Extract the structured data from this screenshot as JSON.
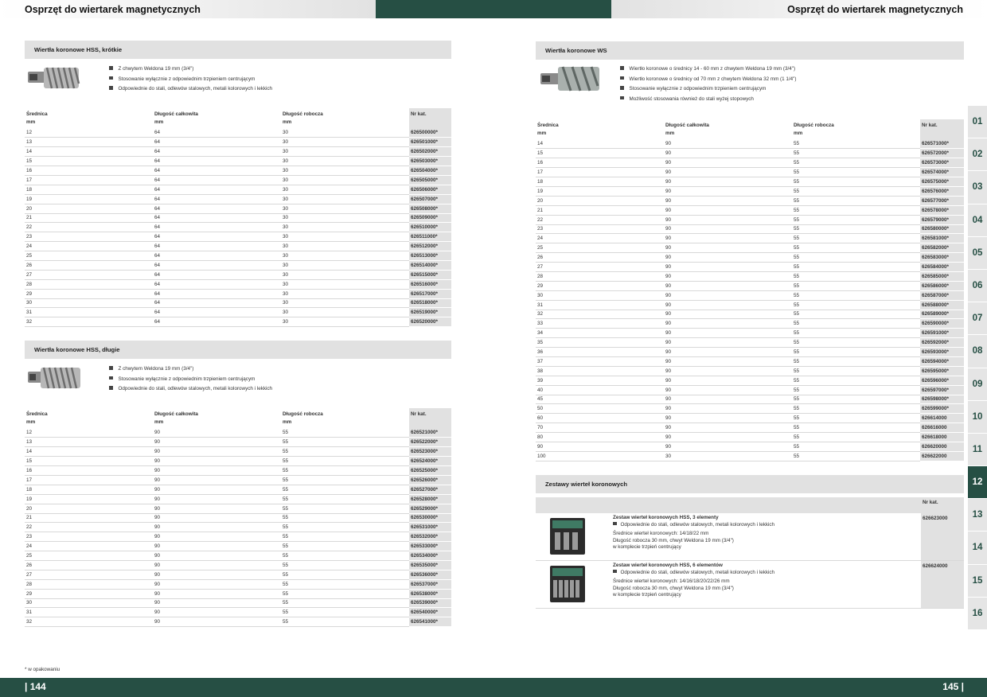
{
  "header": {
    "left_title": "Osprzęt do wiertarek magnetycznych",
    "right_title": "Osprzęt do wiertarek magnetycznych"
  },
  "colors": {
    "brand": "#264f44",
    "section_bg": "#e1e1e1"
  },
  "table_headers": {
    "srednica": "Średnica",
    "dlugosc_calkowita": "Długość całkowita",
    "dlugosc_robocza": "Długość robocza",
    "nr_kat": "Nr kat.",
    "unit": "mm"
  },
  "sec1": {
    "title": "Wiertła koronowe HSS, krótkie",
    "image_icon": "hss-short-core-drill-icon",
    "bullets": [
      "Z chwytem Weldona 19 mm (3/4\")",
      "Stosowanie wyłącznie z odpowiednim trzpieniem centrującym",
      "Odpowiednie do stali, odlewów stalowych, metali kolorowych i lekkich"
    ],
    "rows": [
      [
        "12",
        "64",
        "30",
        "626500000*"
      ],
      [
        "13",
        "64",
        "30",
        "626501000*"
      ],
      [
        "14",
        "64",
        "30",
        "626502000*"
      ],
      [
        "15",
        "64",
        "30",
        "626503000*"
      ],
      [
        "16",
        "64",
        "30",
        "626504000*"
      ],
      [
        "17",
        "64",
        "30",
        "626505000*"
      ],
      [
        "18",
        "64",
        "30",
        "626506000*"
      ],
      [
        "19",
        "64",
        "30",
        "626507000*"
      ],
      [
        "20",
        "64",
        "30",
        "626508000*"
      ],
      [
        "21",
        "64",
        "30",
        "626509000*"
      ],
      [
        "22",
        "64",
        "30",
        "626510000*"
      ],
      [
        "23",
        "64",
        "30",
        "626511000*"
      ],
      [
        "24",
        "64",
        "30",
        "626512000*"
      ],
      [
        "25",
        "64",
        "30",
        "626513000*"
      ],
      [
        "26",
        "64",
        "30",
        "626514000*"
      ],
      [
        "27",
        "64",
        "30",
        "626515000*"
      ],
      [
        "28",
        "64",
        "30",
        "626516000*"
      ],
      [
        "29",
        "64",
        "30",
        "626517000*"
      ],
      [
        "30",
        "64",
        "30",
        "626518000*"
      ],
      [
        "31",
        "64",
        "30",
        "626519000*"
      ],
      [
        "32",
        "64",
        "30",
        "626520000*"
      ]
    ]
  },
  "sec2": {
    "title": "Wiertła koronowe HSS, długie",
    "image_icon": "hss-long-core-drill-icon",
    "bullets": [
      "Z chwytem Weldona 19 mm (3/4\")",
      "Stosowanie wyłącznie z odpowiednim trzpieniem centrującym",
      "Odpowiednie do stali, odlewów stalowych, metali kolorowych i lekkich"
    ],
    "rows": [
      [
        "12",
        "90",
        "55",
        "626521000*"
      ],
      [
        "13",
        "90",
        "55",
        "626522000*"
      ],
      [
        "14",
        "90",
        "55",
        "626523000*"
      ],
      [
        "15",
        "90",
        "55",
        "626524000*"
      ],
      [
        "16",
        "90",
        "55",
        "626525000*"
      ],
      [
        "17",
        "90",
        "55",
        "626526000*"
      ],
      [
        "18",
        "90",
        "55",
        "626527000*"
      ],
      [
        "19",
        "90",
        "55",
        "626528000*"
      ],
      [
        "20",
        "90",
        "55",
        "626529000*"
      ],
      [
        "21",
        "90",
        "55",
        "626530000*"
      ],
      [
        "22",
        "90",
        "55",
        "626531000*"
      ],
      [
        "23",
        "90",
        "55",
        "626532000*"
      ],
      [
        "24",
        "90",
        "55",
        "626533000*"
      ],
      [
        "25",
        "90",
        "55",
        "626534000*"
      ],
      [
        "26",
        "90",
        "55",
        "626535000*"
      ],
      [
        "27",
        "90",
        "55",
        "626536000*"
      ],
      [
        "28",
        "90",
        "55",
        "626537000*"
      ],
      [
        "29",
        "90",
        "55",
        "626538000*"
      ],
      [
        "30",
        "90",
        "55",
        "626539000*"
      ],
      [
        "31",
        "90",
        "55",
        "626540000*"
      ],
      [
        "32",
        "90",
        "55",
        "626541000*"
      ]
    ]
  },
  "sec3": {
    "title": "Wiertła koronowe WS",
    "image_icon": "ws-core-drill-icon",
    "bullets": [
      "Wiertło koronowe o średnicy 14 - 60 mm z chwytem Weldona 19 mm (3/4\")",
      "Wiertło koronowe o średnicy od 70 mm z chwytem Weldona 32 mm (1 1/4\")",
      "Stosowanie wyłącznie z odpowiednim trzpieniem centrującym",
      "Możliwość stosowania również do stali wyżej stopowych"
    ],
    "rows": [
      [
        "14",
        "90",
        "55",
        "626571000*"
      ],
      [
        "15",
        "90",
        "55",
        "626572000*"
      ],
      [
        "16",
        "90",
        "55",
        "626573000*"
      ],
      [
        "17",
        "90",
        "55",
        "626574000*"
      ],
      [
        "18",
        "90",
        "55",
        "626575000*"
      ],
      [
        "19",
        "90",
        "55",
        "626576000*"
      ],
      [
        "20",
        "90",
        "55",
        "626577000*"
      ],
      [
        "21",
        "90",
        "55",
        "626578000*"
      ],
      [
        "22",
        "90",
        "55",
        "626579000*"
      ],
      [
        "23",
        "90",
        "55",
        "626580000*"
      ],
      [
        "24",
        "90",
        "55",
        "626581000*"
      ],
      [
        "25",
        "90",
        "55",
        "626582000*"
      ],
      [
        "26",
        "90",
        "55",
        "626583000*"
      ],
      [
        "27",
        "90",
        "55",
        "626584000*"
      ],
      [
        "28",
        "90",
        "55",
        "626585000*"
      ],
      [
        "29",
        "90",
        "55",
        "626586000*"
      ],
      [
        "30",
        "90",
        "55",
        "626587000*"
      ],
      [
        "31",
        "90",
        "55",
        "626588000*"
      ],
      [
        "32",
        "90",
        "55",
        "626589000*"
      ],
      [
        "33",
        "90",
        "55",
        "626590000*"
      ],
      [
        "34",
        "90",
        "55",
        "626591000*"
      ],
      [
        "35",
        "90",
        "55",
        "626592000*"
      ],
      [
        "36",
        "90",
        "55",
        "626593000*"
      ],
      [
        "37",
        "90",
        "55",
        "626594000*"
      ],
      [
        "38",
        "90",
        "55",
        "626595000*"
      ],
      [
        "39",
        "90",
        "55",
        "626596000*"
      ],
      [
        "40",
        "90",
        "55",
        "626597000*"
      ],
      [
        "45",
        "90",
        "55",
        "626598000*"
      ],
      [
        "50",
        "90",
        "55",
        "626599000*"
      ],
      [
        "60",
        "90",
        "55",
        "626614000"
      ],
      [
        "70",
        "90",
        "55",
        "626616000"
      ],
      [
        "80",
        "90",
        "55",
        "626618000"
      ],
      [
        "90",
        "90",
        "55",
        "626620000"
      ],
      [
        "100",
        "30",
        "55",
        "626622000"
      ]
    ]
  },
  "sets": {
    "title": "Zestawy wierteł koronowych",
    "nr_kat": "Nr kat.",
    "items": [
      {
        "title": "Zestaw wierteł koronowych HSS, 3 elementy",
        "bullet": "Odpowiednie do stali, odlewów stalowych, metali kolorowych i lekkich",
        "line1": "Średnice wierteł koronowych: 14/18/22 mm",
        "line2": "Długość robocza 30 mm, chwyt Weldona 19 mm (3/4\")",
        "line3": "w komplecie trzpień centrujący",
        "nr": "626623000",
        "icon": "drill-set-case-icon"
      },
      {
        "title": "Zestaw wierteł koronowych HSS, 6 elementów",
        "bullet": "Odpowiednie do stali, odlewów stalowych, metali kolorowych i lekkich",
        "line1": "Średnice wierteł koronowych: 14/16/18/20/22/26 mm",
        "line2": "Długość robocza 30 mm, chwyt Weldona 19 mm (3/4\")",
        "line3": "w komplecie trzpień centrujący",
        "nr": "626624000",
        "icon": "drill-set-case-icon"
      }
    ]
  },
  "tabs": [
    "01",
    "02",
    "03",
    "04",
    "05",
    "06",
    "07",
    "08",
    "09",
    "10",
    "11",
    "12",
    "13",
    "14",
    "15",
    "16"
  ],
  "active_tab": "12",
  "footnote": "* w opakowaniu",
  "footer": {
    "left_page": "| 144",
    "right_page": "145 |"
  }
}
